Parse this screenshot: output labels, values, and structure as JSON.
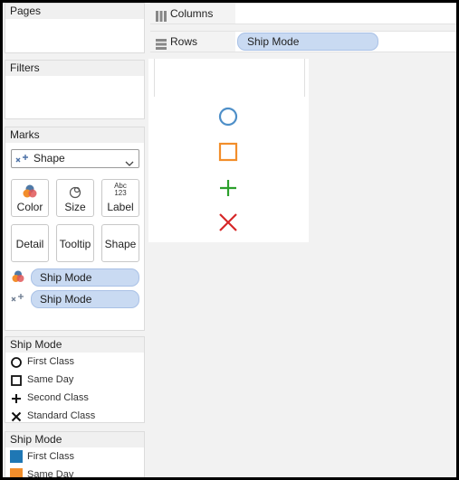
{
  "panels": {
    "pages": {
      "title": "Pages"
    },
    "filters": {
      "title": "Filters"
    },
    "marks": {
      "title": "Marks",
      "mark_type": "Shape",
      "buttons": {
        "color": "Color",
        "size": "Size",
        "label": "Label",
        "detail": "Detail",
        "tooltip": "Tooltip",
        "shape": "Shape"
      },
      "label_icon_text_top": "Abc",
      "label_icon_text_bottom": "123",
      "pills": [
        {
          "icon": "color-icon",
          "label": "Ship Mode"
        },
        {
          "icon": "shape-icon",
          "label": "Ship Mode"
        }
      ]
    }
  },
  "shape_legend": {
    "title": "Ship Mode",
    "items": [
      {
        "shape": "circle",
        "label": "First Class"
      },
      {
        "shape": "square",
        "label": "Same Day"
      },
      {
        "shape": "plus",
        "label": "Second Class"
      },
      {
        "shape": "cross",
        "label": "Standard Class"
      }
    ]
  },
  "color_legend": {
    "title": "Ship Mode",
    "items": [
      {
        "color": "#1f77b4",
        "label": "First Class"
      },
      {
        "color": "#f28e2b",
        "label": "Same Day"
      }
    ]
  },
  "shelves": {
    "columns": {
      "label": "Columns"
    },
    "rows": {
      "label": "Rows",
      "pill": "Ship Mode"
    }
  },
  "view": {
    "marks": [
      {
        "shape": "circle",
        "color": "#4e8fc8"
      },
      {
        "shape": "square",
        "color": "#f28e2b"
      },
      {
        "shape": "plus",
        "color": "#2ca02c"
      },
      {
        "shape": "cross",
        "color": "#d62728"
      }
    ]
  }
}
